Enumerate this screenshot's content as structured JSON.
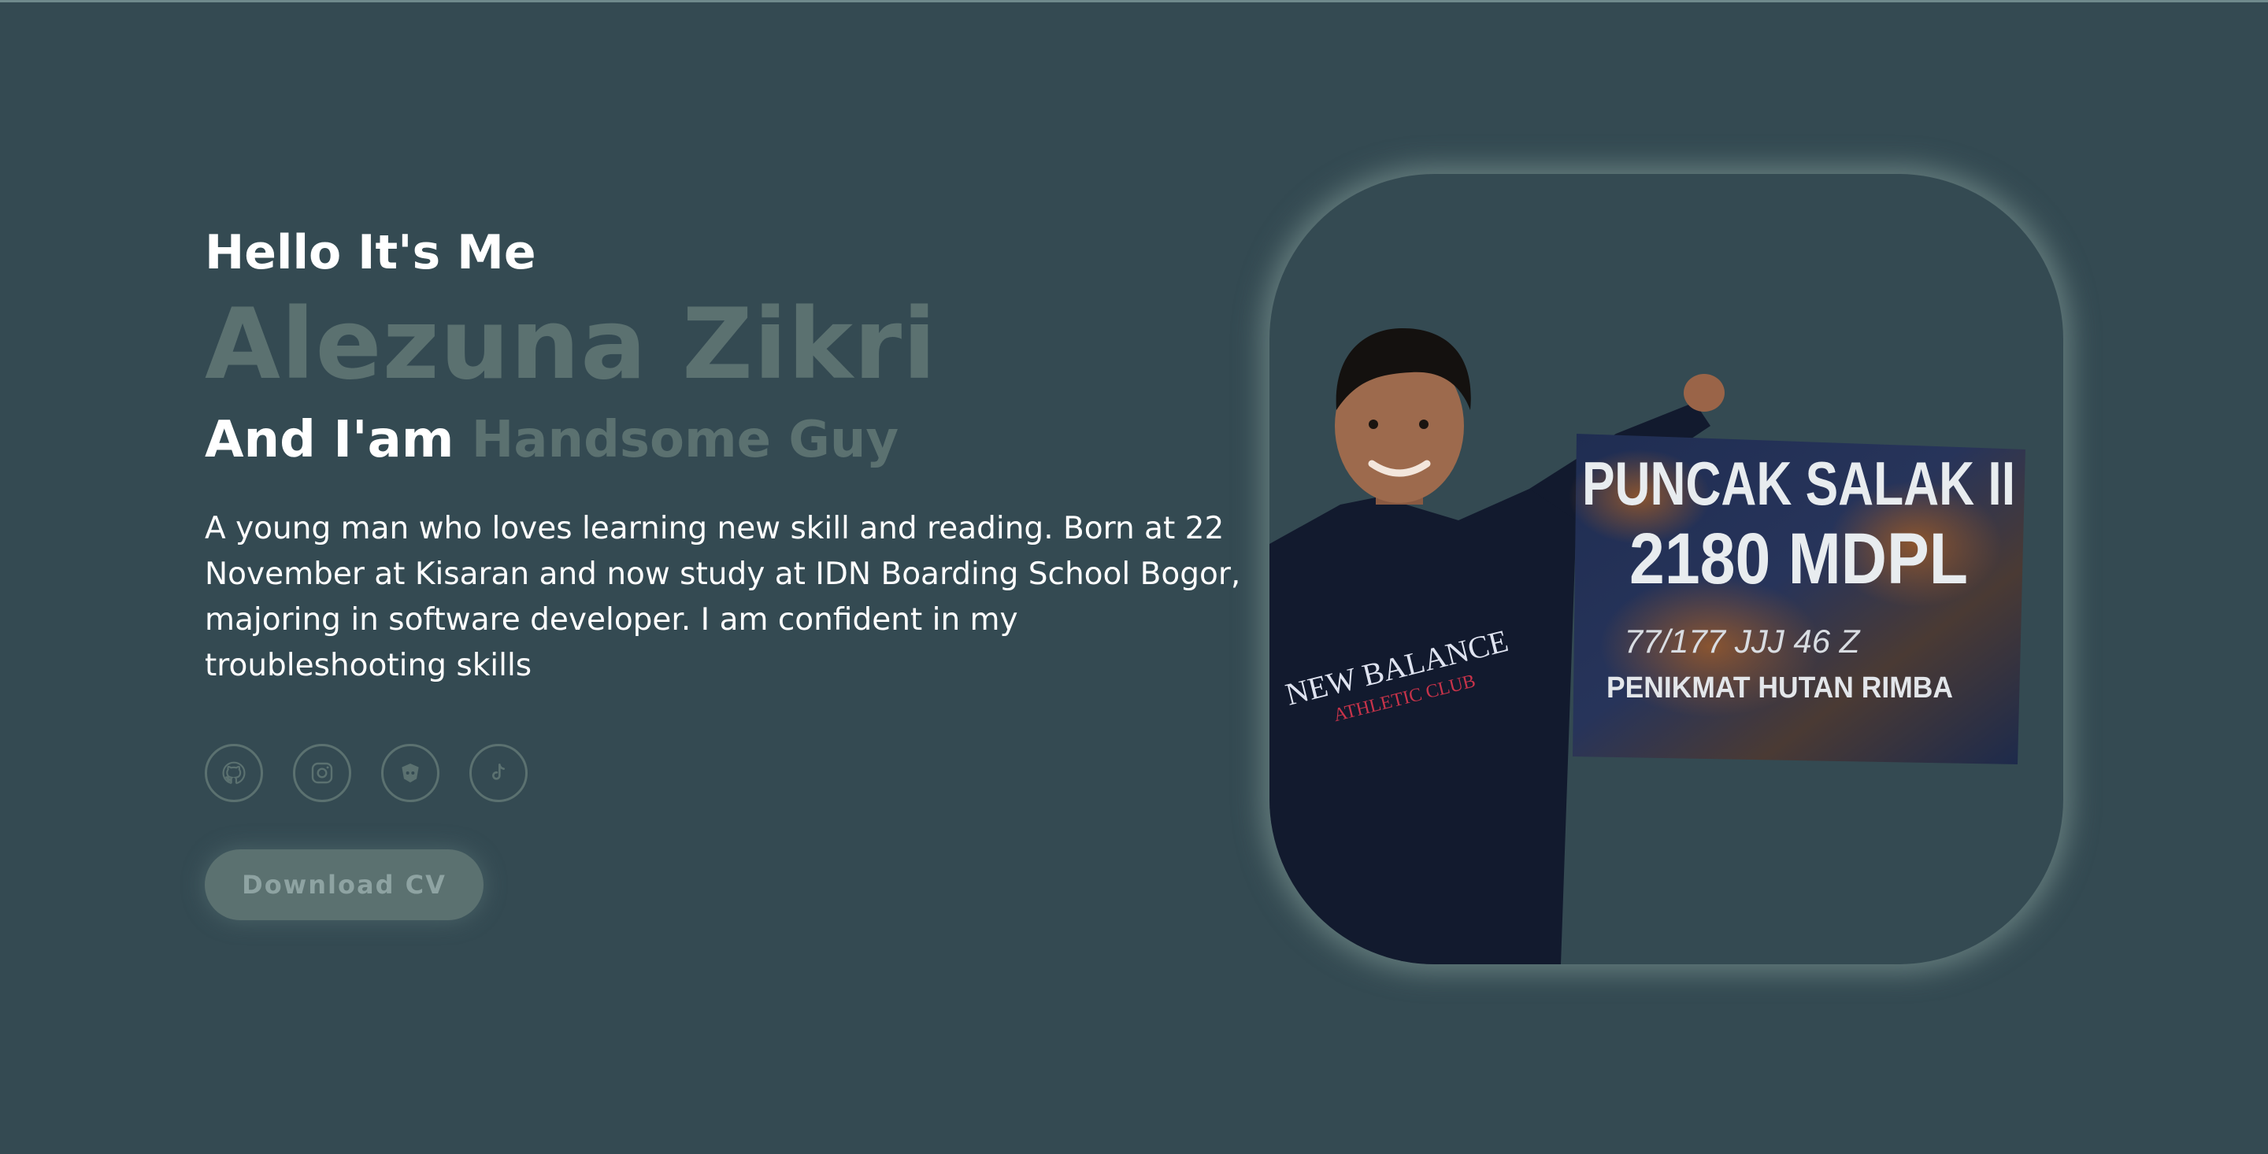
{
  "hero": {
    "greeting": "Hello It's Me",
    "name": "Alezuna Zikri",
    "tagline_prefix": "And I'am",
    "tagline_role": "Handsome Guy",
    "bio": "A young man who loves learning new skill and reading. Born at 22 November at Kisaran and now study at IDN Boarding School Bogor, majoring in software developer. I am confident in my troubleshooting skills",
    "download_label": "Download CV"
  },
  "socials": [
    {
      "icon": "github-icon"
    },
    {
      "icon": "instagram-icon"
    },
    {
      "icon": "discord-icon"
    },
    {
      "icon": "tiktok-icon"
    }
  ],
  "photo": {
    "sign_line1": "PUNCAK SALAK II",
    "sign_line2": "2180 MDPL",
    "sign_line3": "77/177 JJJ 46 Z",
    "sign_line4": "PENIKMAT HUTAN RIMBA",
    "shirt_line1": "NEW BALANCE",
    "shirt_line2": "ATHLETIC CLUB"
  },
  "colors": {
    "background": "#344a52",
    "accent": "#5b7170",
    "text": "#ffffff"
  }
}
